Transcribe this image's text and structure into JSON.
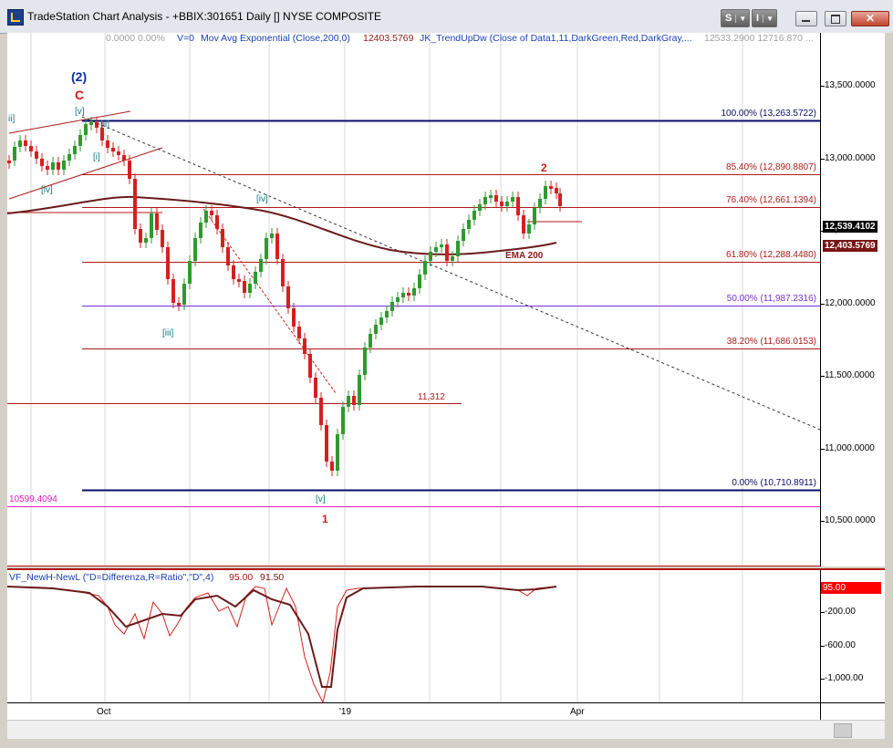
{
  "window": {
    "title": "TradeStation Chart Analysis - +BBIX:301651 Daily [] NYSE COMPOSITE",
    "s_button": "S",
    "i_button": "I"
  },
  "header": {
    "ohlc": "0.0000  0.00%",
    "v": "V=0",
    "mov_avg": "Mov Avg Exponential (Close,200,0)",
    "mov_avg_value": "12403.5769",
    "trend": "JK_TrendUpDw (Close of Data1,11,DarkGreen,Red,DarkGray,...",
    "trend_values": "12533.2900  12716.870 ..."
  },
  "price_axis": {
    "ticks": [
      "13,500.0000",
      "13,000.0000",
      "12,500.0000",
      "12,000.0000",
      "11,500.0000",
      "11,000.0000",
      "10,500.0000"
    ],
    "last_price": "12,539.4102",
    "ema_price": "12,403.5769"
  },
  "fib_levels": [
    {
      "label": "100.00% (13,263.5722)",
      "value": 13263.5722,
      "color": "#0b0b6b"
    },
    {
      "label": "85.40% (12,890.8807)",
      "value": 12890.8807,
      "color": "#b01818"
    },
    {
      "label": "76.40% (12,661.1394)",
      "value": 12661.1394,
      "color": "#b01818"
    },
    {
      "label": "61.80% (12,288.4480)",
      "value": 12288.448,
      "color": "#b01818"
    },
    {
      "label": "50.00% (11,987.2316)",
      "value": 11987.2316,
      "color": "#7a2fd6"
    },
    {
      "label": "38.20% (11,686.0153)",
      "value": 11686.0153,
      "color": "#b01818"
    },
    {
      "label": "0.00% (10,710.8911)",
      "value": 10710.8911,
      "color": "#0b0b6b"
    }
  ],
  "annotations": {
    "wave2_paren": "(2)",
    "wave_c": "C",
    "wave_v_top": "[v]",
    "wave_ii_left": "ii]",
    "wave_ii": "[ii]",
    "wave_i": "[i]",
    "wave_iv_left": "[iv]",
    "wave_iv": "[iv]",
    "wave_iii": "[iii]",
    "wave_v_bottom": "[v]",
    "wave_1": "1",
    "wave_2": "2",
    "ema_label": "EMA 200",
    "level_11312": "11,312",
    "level_10599": "10599.4094"
  },
  "indicator": {
    "title": "VF_NewH-NewL (\"D=Differenza,R=Ratio\",\"D\",4)",
    "v1": "95.00",
    "v2": "91.50",
    "ticks": [
      "-200.00",
      "-600.00",
      "-1,000.00"
    ],
    "current": "95.00"
  },
  "x_axis": {
    "labels": [
      "Oct",
      "'19",
      "Apr"
    ]
  },
  "colors": {
    "up": "#2f9a2f",
    "down": "#d42020",
    "neutral": "#8a8a8a",
    "ema": "#6b1a1a",
    "accent_red": "#ff0000"
  }
}
